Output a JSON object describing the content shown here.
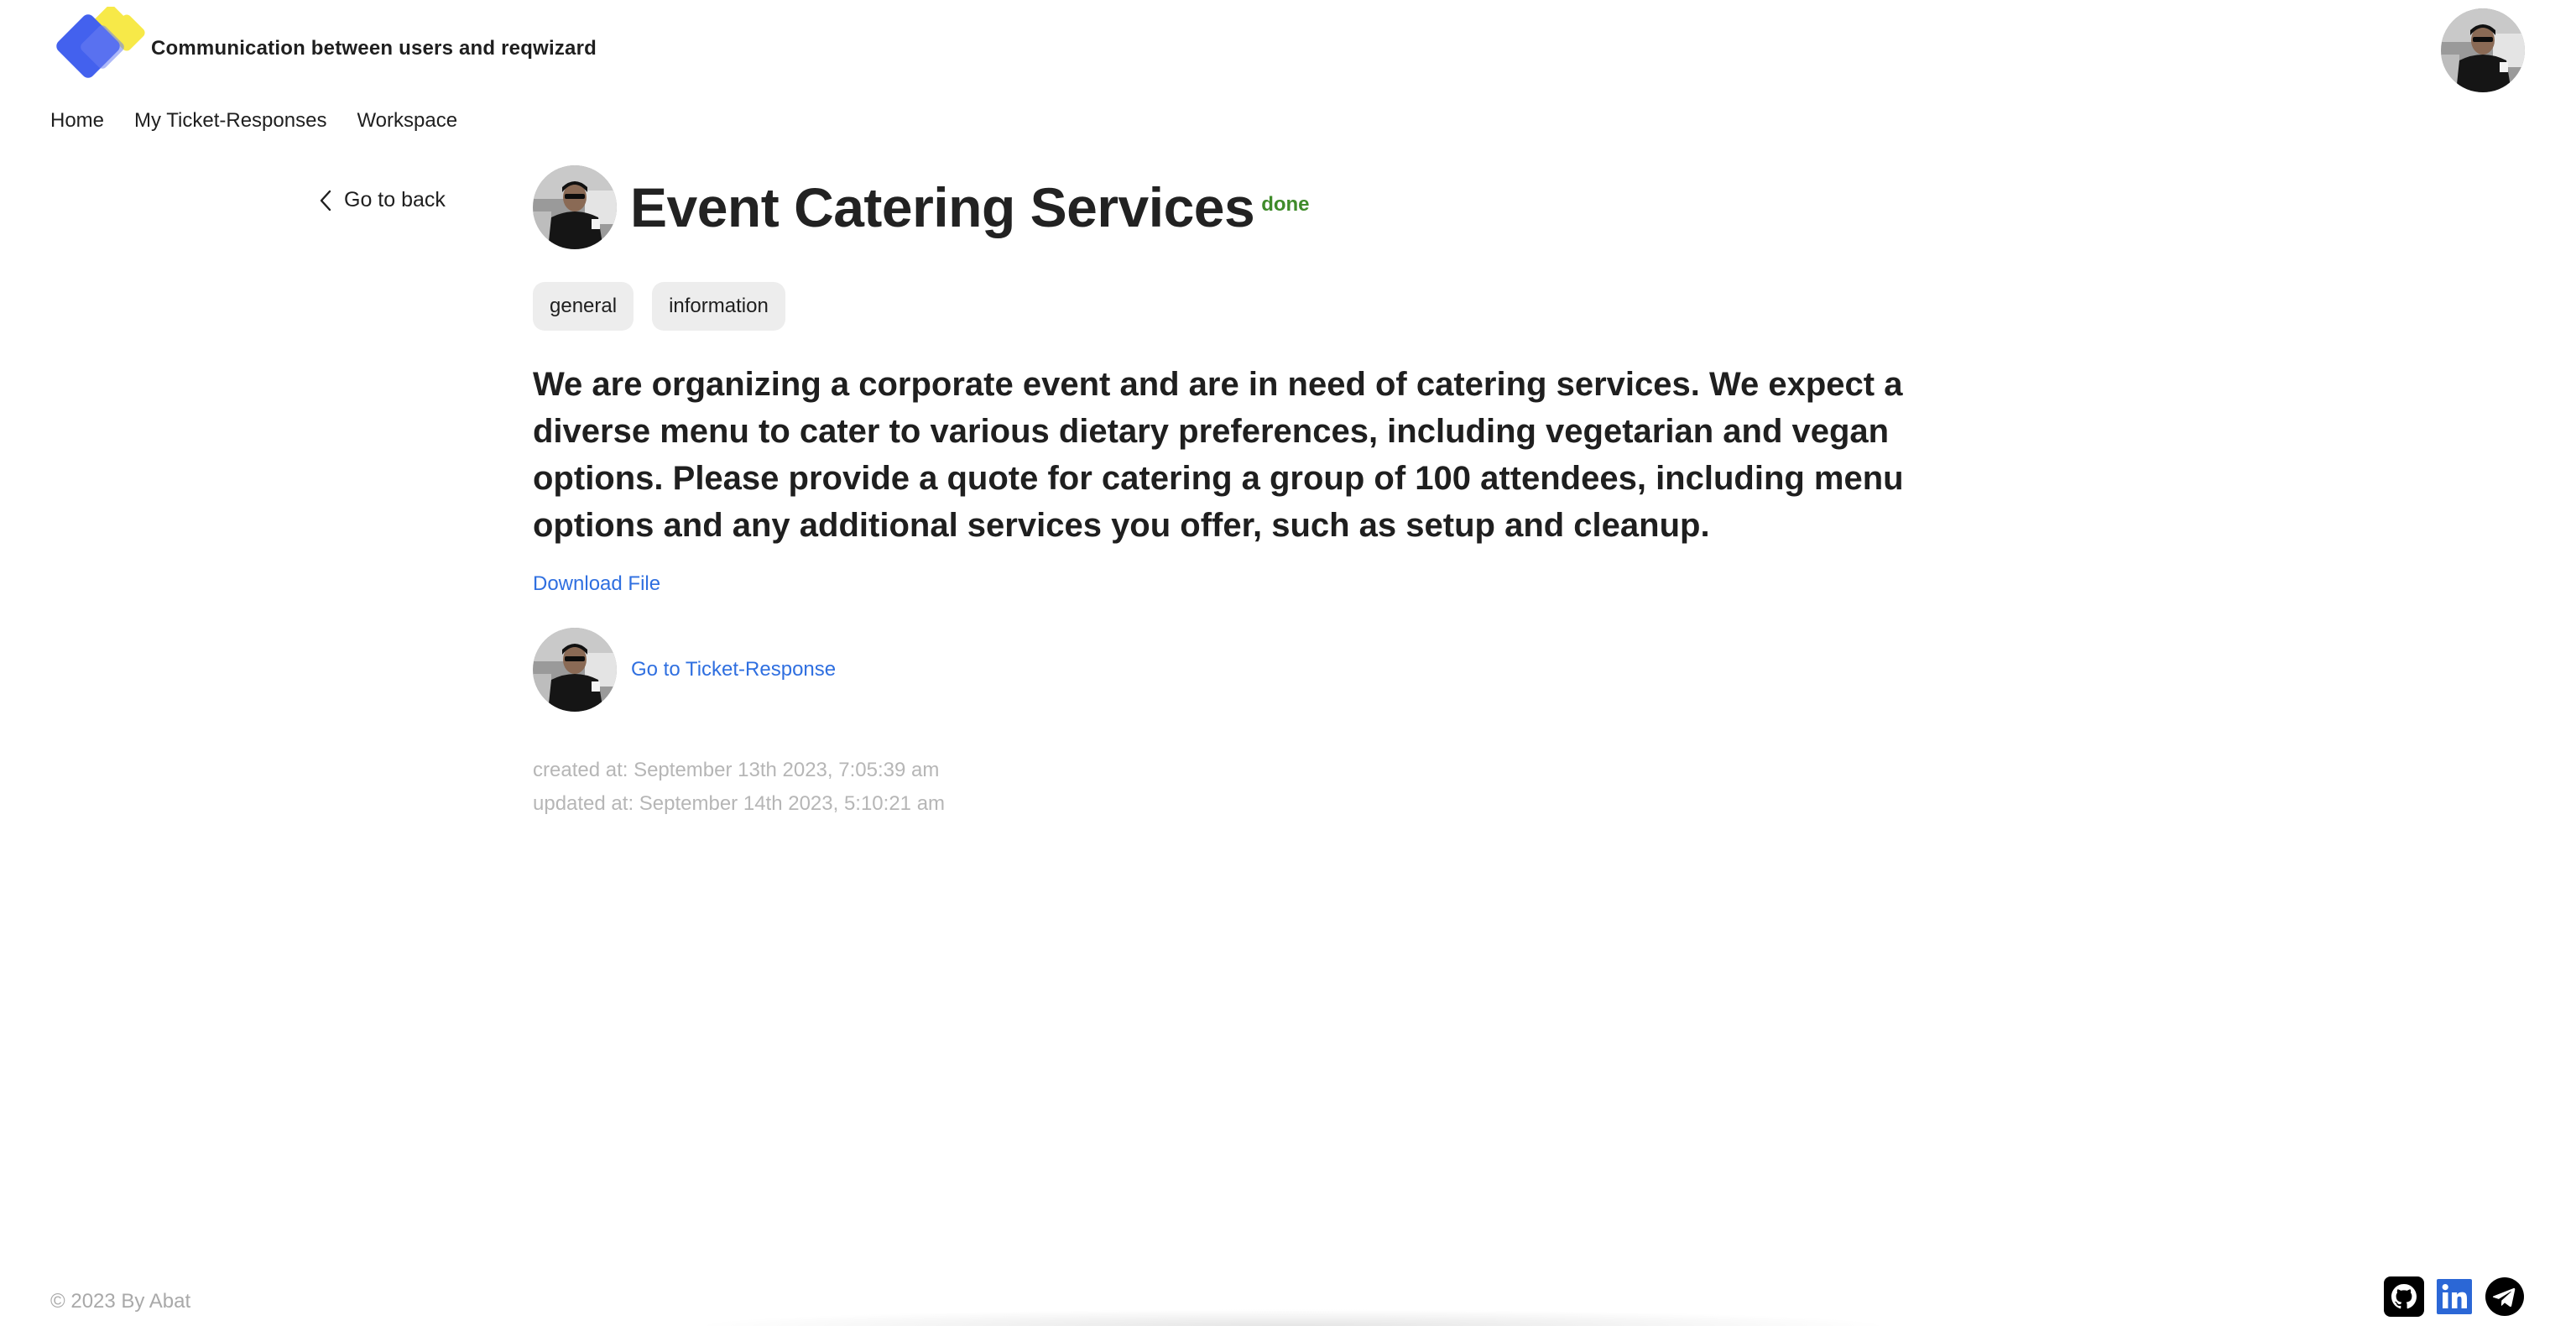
{
  "header": {
    "tagline": "Communication between users and reqwizard",
    "logo_icon": "reqwizard-logo-icon",
    "avatar_icon": "user-avatar-icon"
  },
  "nav": {
    "items": [
      "Home",
      "My Ticket-Responses",
      "Workspace"
    ]
  },
  "back": {
    "label": "Go to back",
    "icon": "chevron-left-icon"
  },
  "ticket": {
    "title": "Event Catering Services",
    "status": "done",
    "tags": [
      "general",
      "information"
    ],
    "description": "We are organizing a corporate event and are in need of catering services. We expect a diverse menu to cater to various dietary preferences, including vegetarian and vegan options. Please provide a quote for catering a group of 100 attendees, including menu options and any additional services you offer, such as setup and cleanup.",
    "download_label": "Download File",
    "response_link_label": "Go to Ticket-Response",
    "created_at": "created at: September 13th 2023, 7:05:39 am",
    "updated_at": "updated at: September 14th 2023, 5:10:21 am"
  },
  "footer": {
    "copyright": "© 2023 By Abat",
    "socials": [
      "github-icon",
      "linkedin-icon",
      "telegram-icon"
    ]
  },
  "colors": {
    "link": "#2f6fe0",
    "status_done": "#3f8b2a",
    "tag_bg": "#ededed",
    "meta_text": "#b6b6b6",
    "logo_blue": "#4361ee",
    "logo_yellow": "#f7e948"
  }
}
